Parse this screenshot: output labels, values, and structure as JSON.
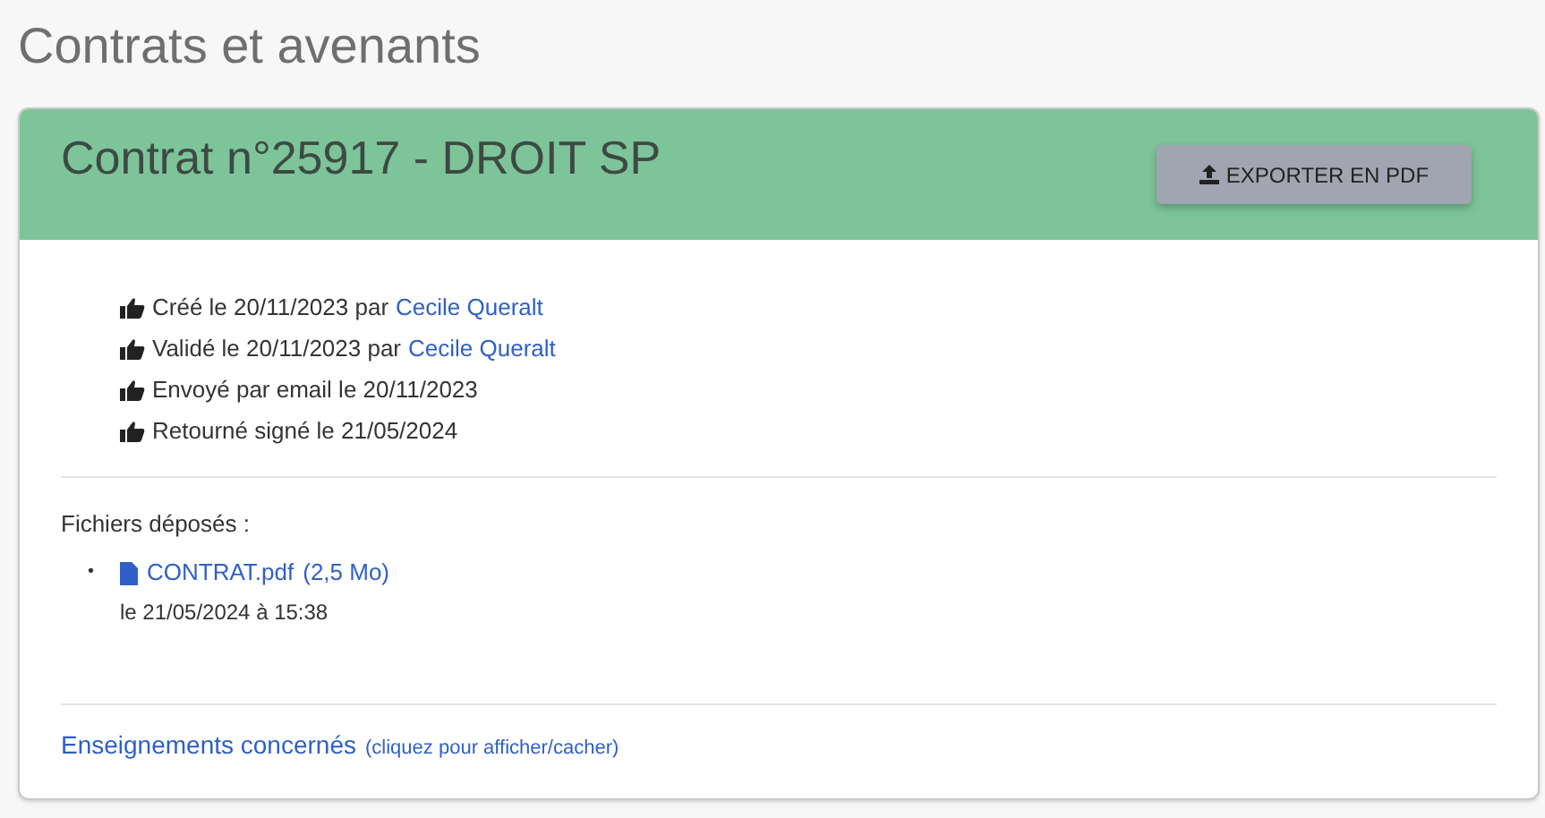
{
  "page_title": "Contrats et avenants",
  "contract": {
    "title": "Contrat n°25917 - DROIT SP",
    "export_button": "EXPORTER EN PDF",
    "history": [
      {
        "text": "Créé le 20/11/2023 par",
        "author": "Cecile Queralt"
      },
      {
        "text": "Validé le 20/11/2023 par",
        "author": "Cecile Queralt"
      },
      {
        "text": "Envoyé par email le 20/11/2023"
      },
      {
        "text": "Retourné signé le 21/05/2024"
      }
    ],
    "files_label": "Fichiers déposés :",
    "files": [
      {
        "bullet": "•",
        "name": "CONTRAT.pdf",
        "size": "(2,5 Mo)",
        "date": "le 21/05/2024 à 15:38"
      }
    ],
    "courses_toggle": {
      "label": "Enseignements concernés",
      "hint": "(cliquez pour afficher/cacher)"
    }
  }
}
